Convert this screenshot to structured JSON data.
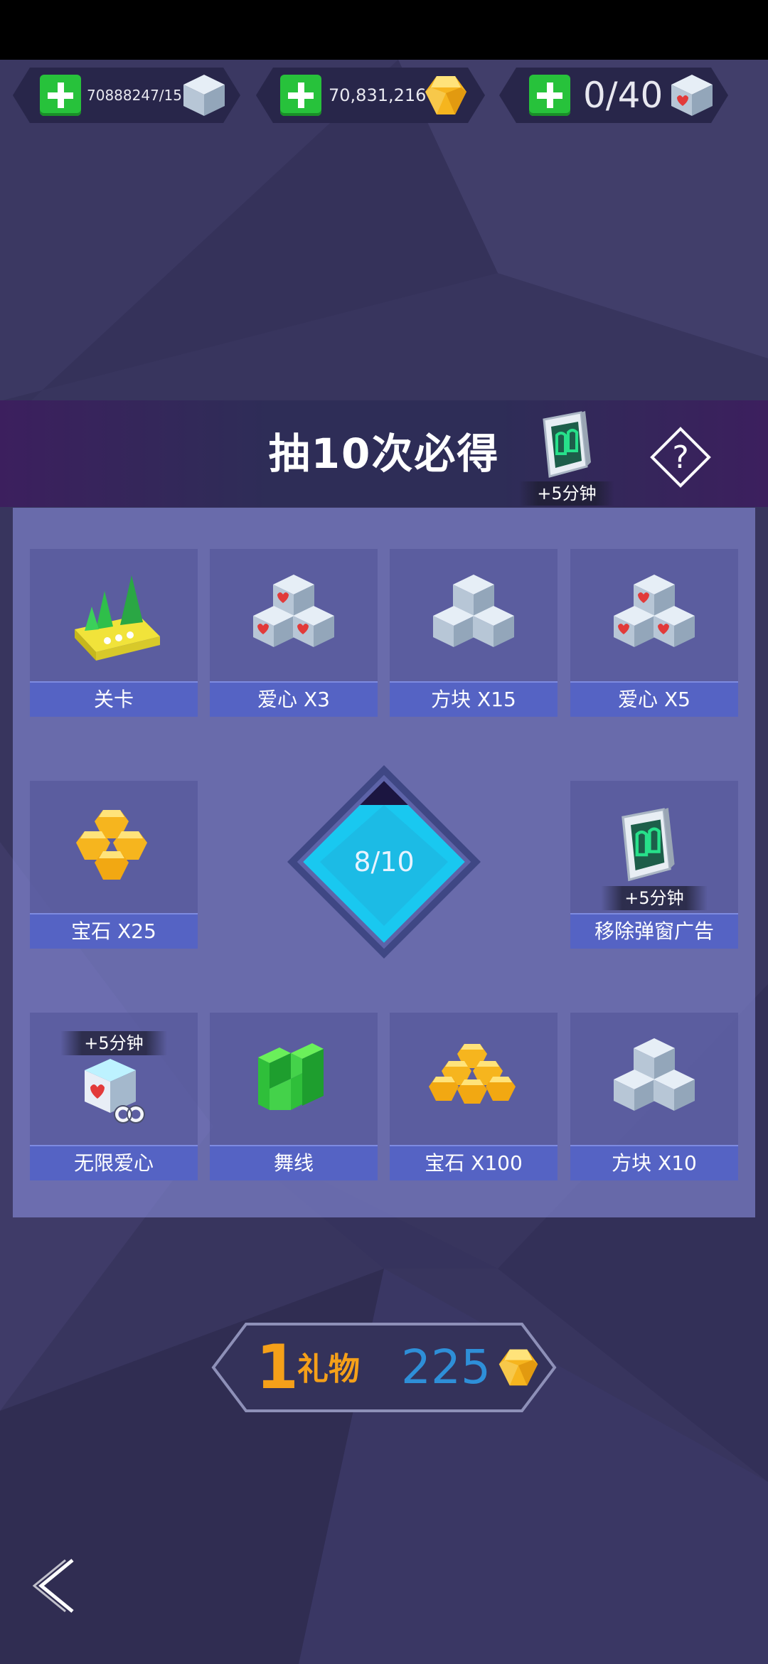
{
  "currencies": [
    {
      "value": "70888247/15",
      "icon": "cube-icon"
    },
    {
      "value": "70,831,216",
      "icon": "gem-icon"
    },
    {
      "value": "0/40",
      "icon": "heart-cube-icon"
    }
  ],
  "banner": {
    "title": "抽10次必得",
    "prize_icon": "window-frame-icon",
    "prize_bonus": "+5分钟",
    "help_icon": "question-icon"
  },
  "prizes": [
    {
      "label": "关卡",
      "icon": "level-island-icon"
    },
    {
      "label": "爱心 X3",
      "icon": "heart-cubes-icon"
    },
    {
      "label": "方块 X15",
      "icon": "cubes-icon"
    },
    {
      "label": "爱心 X5",
      "icon": "heart-cubes-icon"
    },
    {
      "label": "宝石 X25",
      "icon": "gems-icon"
    },
    {
      "label": "移除弹窗广告",
      "icon": "window-frame-icon",
      "bonus": "+5分钟"
    },
    {
      "label": "无限爱心",
      "icon": "infinite-heart-icon",
      "bonus": "+5分钟"
    },
    {
      "label": "舞线",
      "icon": "green-line-icon"
    },
    {
      "label": "宝石 X100",
      "icon": "gems-icon"
    },
    {
      "label": "方块 X10",
      "icon": "cubes-icon"
    }
  ],
  "progress": {
    "text": "8/10",
    "value": 8,
    "max": 10
  },
  "gift": {
    "count": "1",
    "label": "礼物",
    "cost": "225",
    "icon": "gem-icon"
  },
  "nav": {
    "back_icon": "chevron-left-icon"
  },
  "colors": {
    "accent_green": "#27c23b",
    "gift_orange": "#f5a019",
    "cost_blue": "#2e8fd8",
    "label_blue": "#5563c4",
    "diamond_cyan": "#19c8f0"
  }
}
